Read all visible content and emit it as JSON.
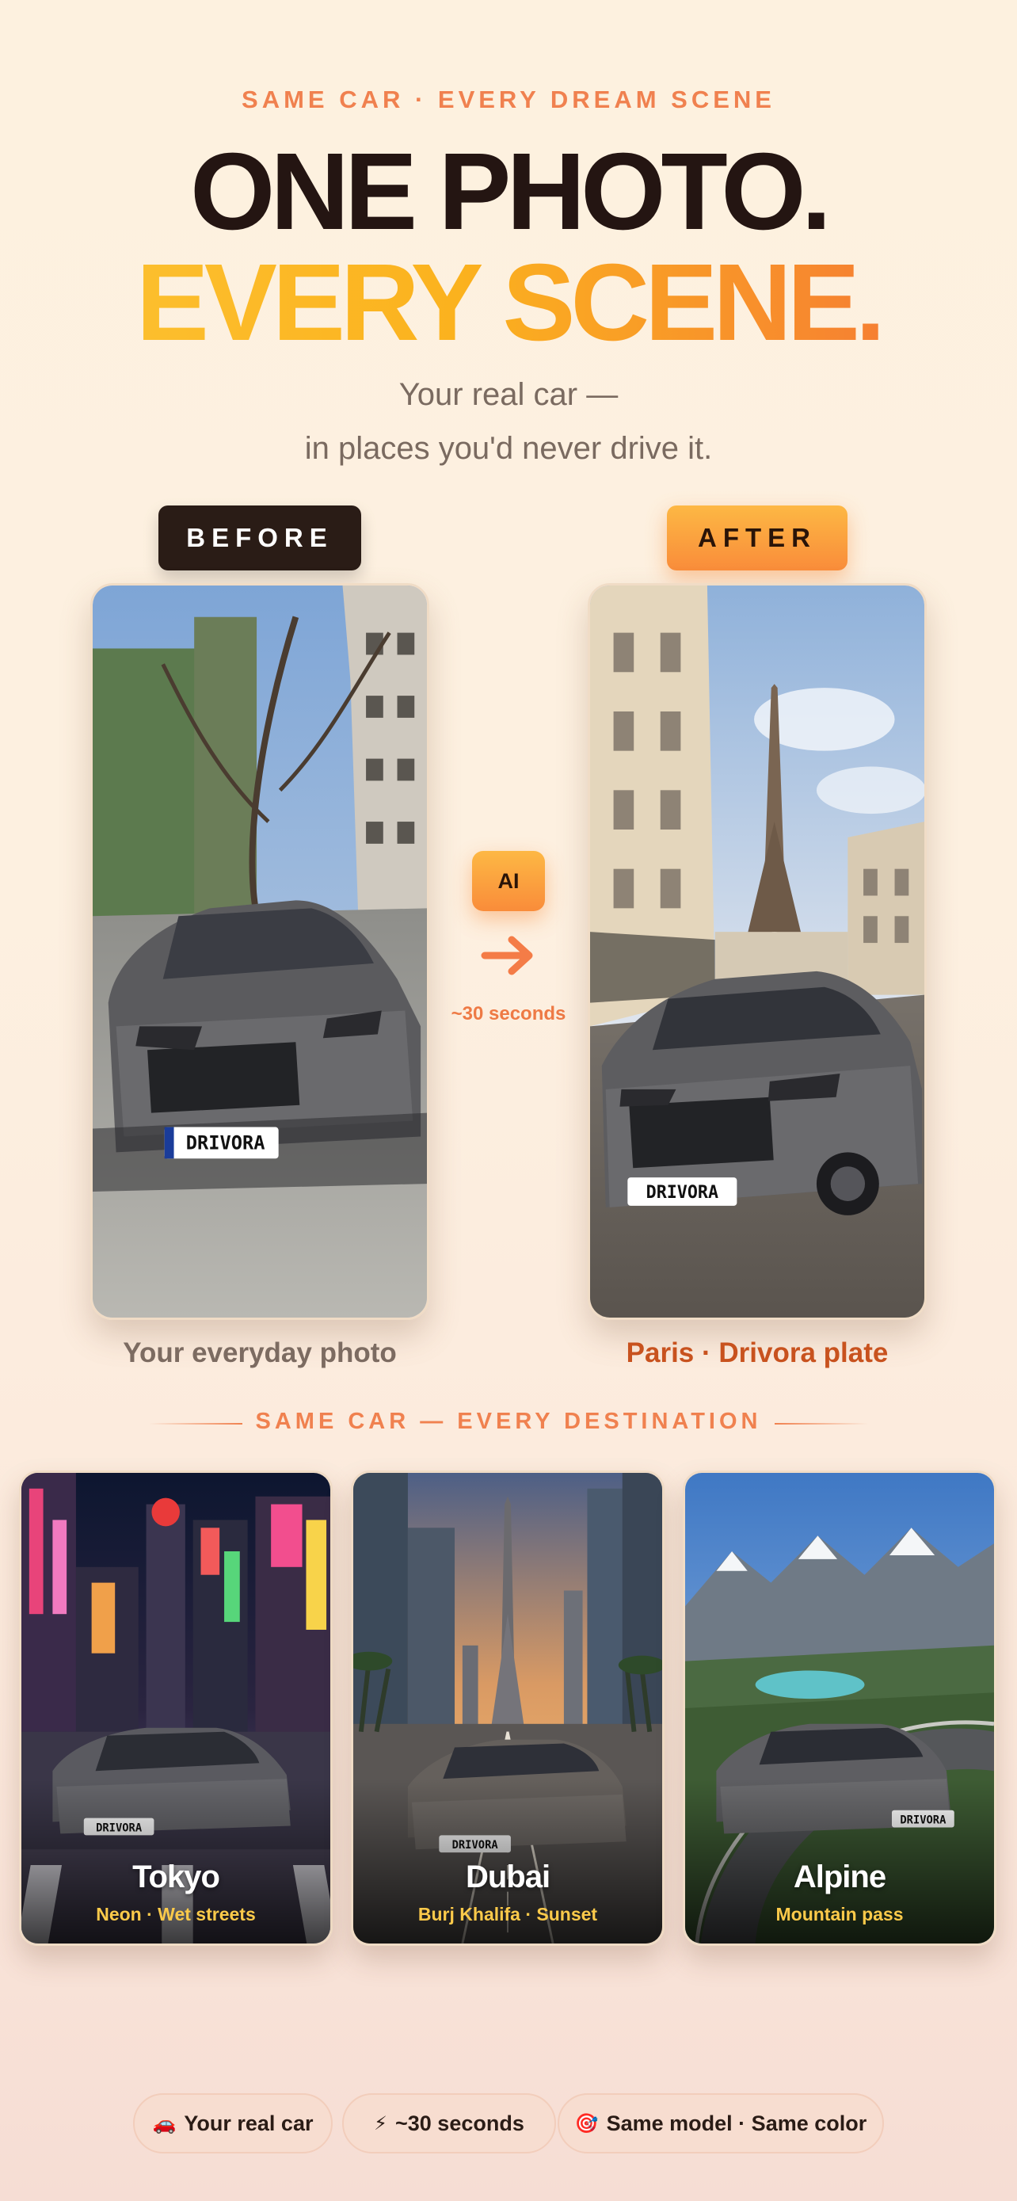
{
  "header": {
    "eyebrow": "SAME CAR · EVERY DREAM SCENE",
    "title_line1": "ONE PHOTO.",
    "title_line2": "EVERY SCENE.",
    "subtitle_line1": "Your real car —",
    "subtitle_line2": "in places you'd never drive it."
  },
  "comparison": {
    "before_tag": "BEFORE",
    "after_tag": "AFTER",
    "ai_badge": "AI",
    "duration": "~30 seconds",
    "before_caption": "Your everyday photo",
    "after_caption": "Paris · Drivora plate",
    "plate_text": "DRIVORA"
  },
  "destinations": {
    "heading": "SAME CAR — EVERY DESTINATION",
    "cards": [
      {
        "title": "Tokyo",
        "subtitle": "Neon · Wet streets"
      },
      {
        "title": "Dubai",
        "subtitle": "Burj Khalifa · Sunset"
      },
      {
        "title": "Alpine",
        "subtitle": "Mountain pass"
      }
    ]
  },
  "features": [
    {
      "icon": "car-icon",
      "glyph": "🚗",
      "label": "Your real car"
    },
    {
      "icon": "lightning-icon",
      "glyph": "⚡",
      "label": "~30 seconds"
    },
    {
      "icon": "target-icon",
      "glyph": "🎯",
      "label": "Same model · Same color"
    }
  ],
  "colors": {
    "accent_orange": "#f0814f",
    "gradient_yellow": "#fdc434",
    "gradient_orange": "#f36c3a",
    "dark_text": "#241512"
  }
}
